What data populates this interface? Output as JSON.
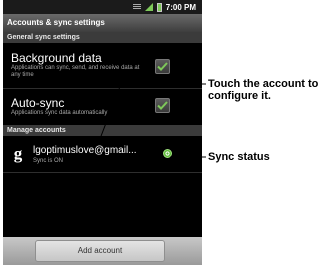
{
  "status_bar": {
    "time": "7:00 PM"
  },
  "title_bar": {
    "title": "Accounts & sync settings"
  },
  "general_section": {
    "header": "General sync settings"
  },
  "background_data": {
    "title": "Background data",
    "subtitle": "Applications can sync, send, and receive data at any time",
    "checked": true
  },
  "auto_sync": {
    "title": "Auto-sync",
    "subtitle": "Applications sync data automatically",
    "checked": true
  },
  "manage_section": {
    "header": "Manage accounts"
  },
  "account": {
    "icon_letter": "g",
    "email": "lgoptimuslove@gmail...",
    "status": "Sync is ON",
    "sync_icon": "sync-on-icon"
  },
  "bottom_bar": {
    "add_account_label": "Add account"
  },
  "callouts": {
    "account_note_line1": "Touch the account to",
    "account_note_line2": "configure it.",
    "sync_status_label": "Sync status"
  },
  "colors": {
    "check_green": "#7ec85a",
    "sync_green": "#5fb83a"
  }
}
